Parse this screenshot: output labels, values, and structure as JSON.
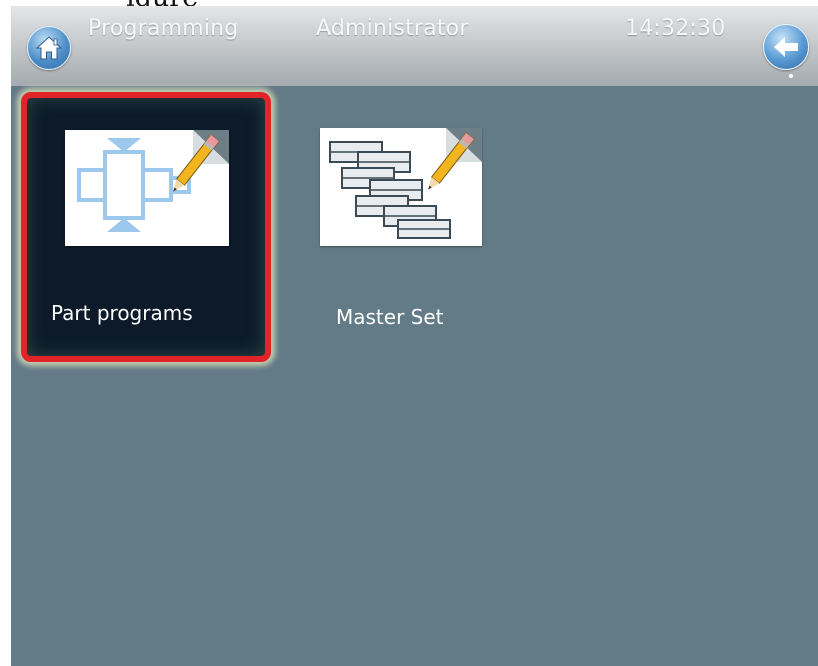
{
  "caption_fragment": "igure",
  "title_bar": {
    "section": "Programming",
    "user": "Administrator",
    "clock": "14:32:30",
    "home_icon": "home-icon",
    "back_icon": "arrow-left-icon"
  },
  "tiles": [
    {
      "label": "Part programs",
      "icon": "part-program-edit-icon",
      "selected": true
    },
    {
      "label": "Master Set",
      "icon": "master-set-edit-icon",
      "selected": false
    }
  ],
  "colors": {
    "content_background": "#637a87",
    "selection_border": "#e02427",
    "selected_tile_background": "#0c1a2a",
    "title_text": "#f7f8f9"
  }
}
